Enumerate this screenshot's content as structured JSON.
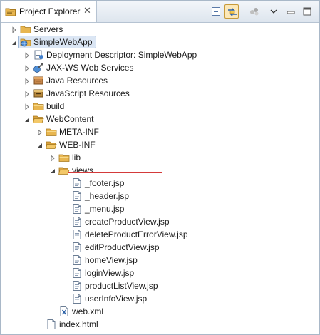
{
  "tab": {
    "title": "Project Explorer",
    "close_glyph": "✕",
    "icon": "project-explorer-icon"
  },
  "toolbar": [
    {
      "name": "collapse-all-button",
      "icon": "collapse-all-icon"
    },
    {
      "name": "link-with-editor-button",
      "icon": "link-with-editor-icon",
      "active": true
    },
    {
      "name": "focus-on-active-task-button",
      "icon": "mylyn-task-icon"
    },
    {
      "name": "view-menu-button",
      "icon": "chevron-down-icon"
    },
    {
      "name": "minimize-button",
      "icon": "minimize-icon"
    },
    {
      "name": "maximize-button",
      "icon": "maximize-icon"
    }
  ],
  "tree": [
    {
      "label": "Servers",
      "icon": "folder-icon",
      "arrow": "collapsed"
    },
    {
      "label": "SimpleWebApp",
      "icon": "web-project-icon",
      "arrow": "expanded",
      "selected": true
    },
    {
      "label": "Deployment Descriptor: SimpleWebApp",
      "icon": "deployment-descriptor-icon",
      "arrow": "collapsed"
    },
    {
      "label": "JAX-WS Web Services",
      "icon": "web-services-icon",
      "arrow": "collapsed"
    },
    {
      "label": "Java Resources",
      "icon": "java-resources-icon",
      "arrow": "collapsed"
    },
    {
      "label": "JavaScript Resources",
      "icon": "javascript-resources-icon",
      "arrow": "collapsed"
    },
    {
      "label": "build",
      "icon": "folder-icon",
      "arrow": "collapsed"
    },
    {
      "label": "WebContent",
      "icon": "folder-open-icon",
      "arrow": "expanded"
    },
    {
      "label": "META-INF",
      "icon": "folder-icon",
      "arrow": "collapsed"
    },
    {
      "label": "WEB-INF",
      "icon": "folder-open-icon",
      "arrow": "expanded"
    },
    {
      "label": "lib",
      "icon": "folder-icon",
      "arrow": "collapsed"
    },
    {
      "label": "views",
      "icon": "folder-open-icon",
      "arrow": "expanded"
    },
    {
      "label": "_footer.jsp",
      "icon": "jsp-file-icon",
      "arrow": "none"
    },
    {
      "label": "_header.jsp",
      "icon": "jsp-file-icon",
      "arrow": "none"
    },
    {
      "label": "_menu.jsp",
      "icon": "jsp-file-icon",
      "arrow": "none"
    },
    {
      "label": "createProductView.jsp",
      "icon": "jsp-file-icon",
      "arrow": "none"
    },
    {
      "label": "deleteProductErrorView.jsp",
      "icon": "jsp-file-icon",
      "arrow": "none"
    },
    {
      "label": "editProductView.jsp",
      "icon": "jsp-file-icon",
      "arrow": "none"
    },
    {
      "label": "homeView.jsp",
      "icon": "jsp-file-icon",
      "arrow": "none"
    },
    {
      "label": "loginView.jsp",
      "icon": "jsp-file-icon",
      "arrow": "none"
    },
    {
      "label": "productListView.jsp",
      "icon": "jsp-file-icon",
      "arrow": "none"
    },
    {
      "label": "userInfoView.jsp",
      "icon": "jsp-file-icon",
      "arrow": "none"
    },
    {
      "label": "web.xml",
      "icon": "xml-file-icon",
      "arrow": "none"
    },
    {
      "label": "index.html",
      "icon": "html-file-icon",
      "arrow": "none"
    }
  ],
  "colors": {
    "selection": "#dbe6f4",
    "highlight_box": "#d43a3a",
    "folder": "#e8b650"
  }
}
